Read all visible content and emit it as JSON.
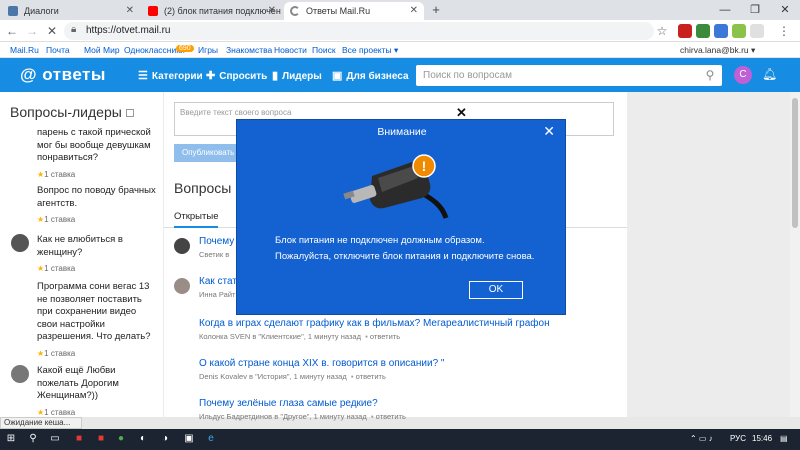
{
  "browser": {
    "tabs": [
      {
        "label": "Диалоги",
        "color": "#4a76a8"
      },
      {
        "label": "(2) блок питания подключен и...",
        "color": "#ff0000"
      },
      {
        "label": "Ответы Mail.Ru",
        "color": "#888888"
      }
    ],
    "new_tab": "+",
    "url": "https://otvet.mail.ru"
  },
  "portal": {
    "links": [
      "Mail.Ru",
      "Почта",
      "Мой Мир",
      "Одноклассники",
      "Игры",
      "Знакомства",
      "Новости",
      "Поиск",
      "Все проекты ▾"
    ],
    "mail_badge": "",
    "ok_badge": "690",
    "user": "chirva.lana@bk.ru ▾"
  },
  "header": {
    "logo": "@ ответы",
    "nav": [
      "Категории",
      "Спросить",
      "Лидеры",
      "Для бизнеса"
    ],
    "search_placeholder": "Поиск по вопросам",
    "avatar_letter": "C"
  },
  "sidebar": {
    "title": "Вопросы-лидеры",
    "items": [
      {
        "text": "парень с такой прической мог бы вообще девушкам понравиться?",
        "stake": "1 ставка"
      },
      {
        "text": "Вопрос по поводу брачных агентств.",
        "stake": "1 ставка"
      },
      {
        "text": "Как не влюбиться в женщину?",
        "stake": "1 ставка"
      },
      {
        "text": "Программа сони вегас 13 не позволяет поставить при сохранении видео свои настройки разрешения. Что делать?",
        "stake": "1 ставка"
      },
      {
        "text": "Какой ещё Любви пожелать Дорогим Женщинам?))",
        "stake": "1 ставка"
      }
    ]
  },
  "main": {
    "ask_placeholder": "Введите текст своего вопроса",
    "publish": "Опубликовать",
    "heading": "Вопросы",
    "tab": "Открытые",
    "questions": [
      {
        "title": "Почему у",
        "meta": "Светик в "
      },
      {
        "title": "Как стать",
        "meta": "Инна Райт"
      },
      {
        "title": "Когда в играх сделают графику как в фильмах? Мегареалистичный графон",
        "meta": "Колонка SVEN в \"Клиентские\", 1 минуту назад",
        "action": "ответить"
      },
      {
        "title": "О какой стране конца XIX в. говорится в описании? \"",
        "meta": "Denis Kovalev в \"История\", 1 минуту назад",
        "action": "ответить"
      },
      {
        "title": "Почему зелёные глаза самые редкие?",
        "meta": "Ильдус Бадретдинов в \"Другое\", 1 минуту назад",
        "action": "ответить"
      }
    ]
  },
  "dialog": {
    "title": "Внимание",
    "close": "✕",
    "line1": "Блок питания не подключен должным образом.",
    "line2": "Пожалуйста, отключите блок питания и подключите снова.",
    "ok": "OK"
  },
  "statusbar": "Ожидание кеша...",
  "taskbar": {
    "lang": "РУС",
    "time": "15:46"
  },
  "colors": {
    "brand": "#168de2",
    "dialog": "#1462d1",
    "link": "#005bd1"
  }
}
